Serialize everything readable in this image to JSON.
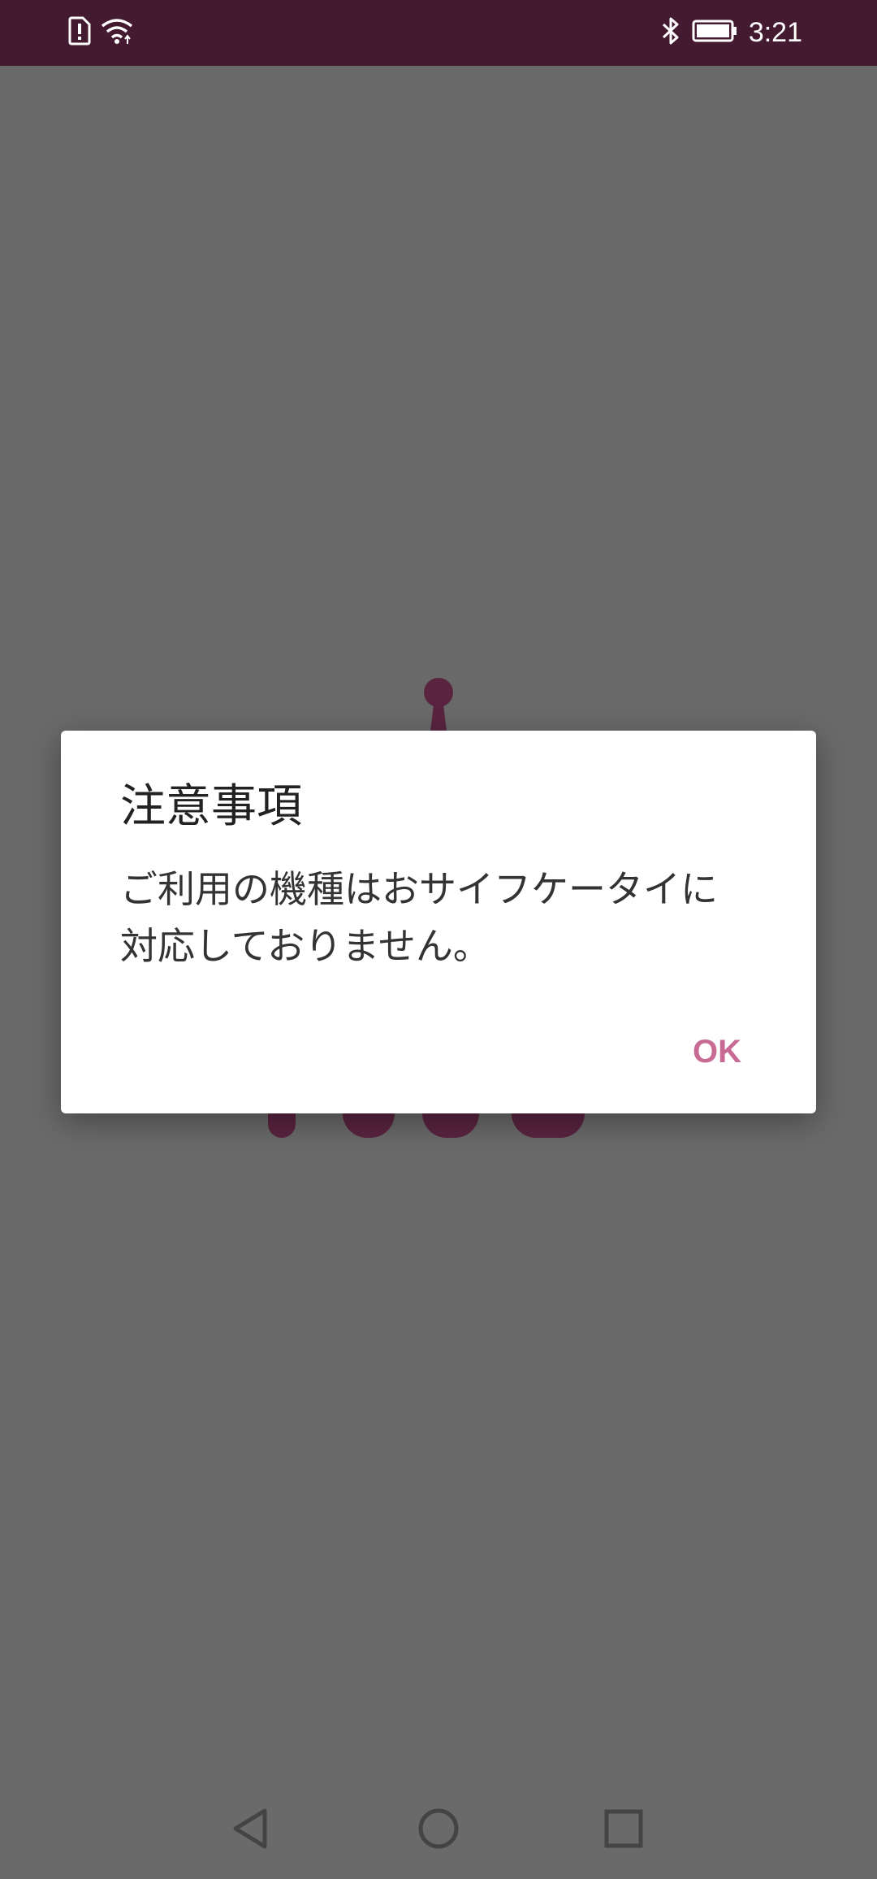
{
  "status_bar": {
    "time": "3:21",
    "icons": [
      "sim-alert-icon",
      "wifi-icon",
      "bluetooth-icon",
      "battery-icon"
    ]
  },
  "dialog": {
    "title": "注意事項",
    "message_line1": "ご利用の機種はおサイフケータイに",
    "message_line2": "対応しておりません。",
    "ok_label": "OK"
  },
  "navigation": {
    "icons": [
      "back-icon",
      "home-icon",
      "recents-icon"
    ]
  },
  "colors": {
    "status_bar": "#441a30",
    "scrim_background": "#6a6a6a",
    "accent": "#c86a94",
    "brand_logo": "#5a2440"
  }
}
